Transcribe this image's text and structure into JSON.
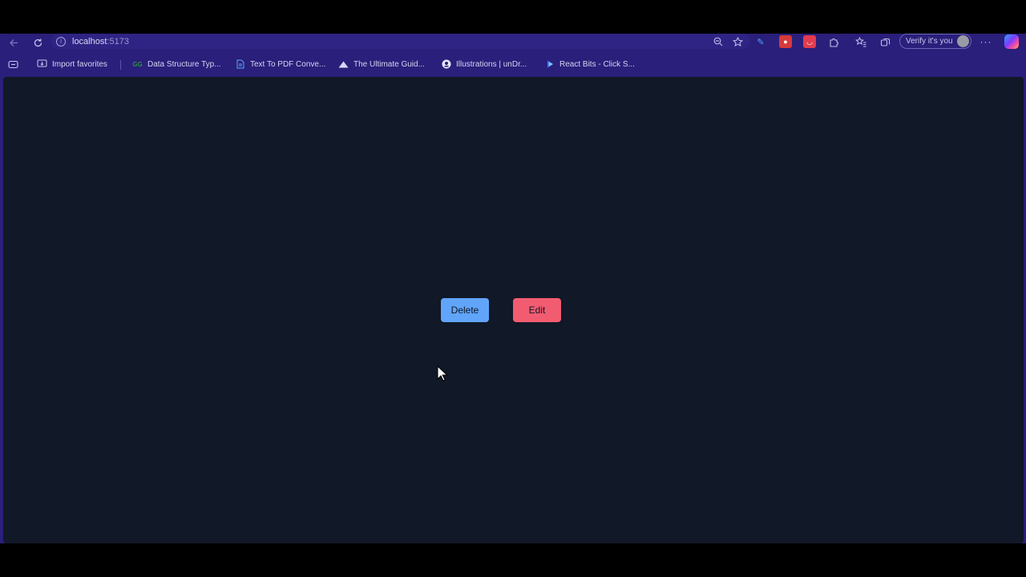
{
  "browser": {
    "address_bar": {
      "host": "localhost",
      "port": ":5173"
    },
    "profile": {
      "label": "Verify it's you"
    },
    "icons": {
      "back": "arrow-left",
      "reload": "reload",
      "site_info": "info",
      "zoom": "zoom-out",
      "favorite": "star",
      "menu": "more-horizontal"
    }
  },
  "bookmarks": [
    {
      "label": "Import favorites",
      "icon": "import"
    },
    {
      "label": "Data Structure Typ...",
      "icon": "gfg-logo"
    },
    {
      "label": "Text To PDF Conve...",
      "icon": "document-text"
    },
    {
      "label": "The Ultimate Guid...",
      "icon": "mountain"
    },
    {
      "label": "Illustrations | unDr...",
      "icon": "undraw-logo"
    },
    {
      "label": "React Bits - Click S...",
      "icon": "react-bits-logo"
    }
  ],
  "page": {
    "buttons": {
      "delete_label": "Delete",
      "edit_label": "Edit"
    }
  },
  "colors": {
    "browser_chrome": "#2a1f7a",
    "page_background": "#111827",
    "delete_button": "#60a5fa",
    "edit_button": "#f25c70"
  }
}
